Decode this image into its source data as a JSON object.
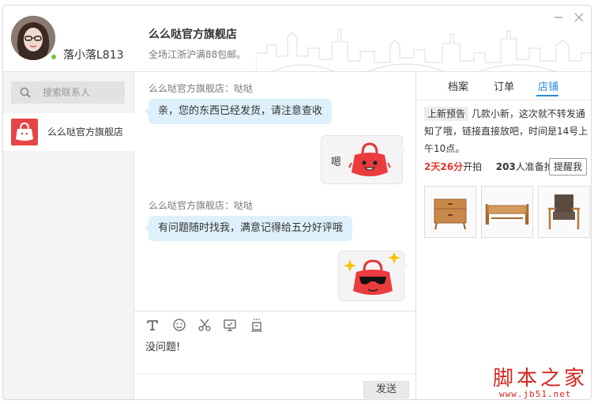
{
  "header": {
    "username": "落小落L813",
    "shop_title": "么么哒官方旗舰店",
    "shop_subtitle": "全场江浙沪满88包邮。"
  },
  "sidebar": {
    "search_placeholder": "搜索联系人",
    "contacts": [
      {
        "name": "么么哒官方旗舰店"
      }
    ]
  },
  "chat": {
    "messages": [
      {
        "sender": "么么哒官方旗舰店：哒哒",
        "text": "亲，您的东西已经发货，请注意查收"
      },
      {
        "text": "嗯",
        "sticker": "red-bag-happy"
      },
      {
        "sender": "么么哒官方旗舰店：哒哒",
        "text": "有问题随时找我，满意记得给五分好评哦"
      },
      {
        "sticker": "red-bag-sunglasses"
      }
    ]
  },
  "composer": {
    "tools": [
      "text-format-icon",
      "emoji-icon",
      "scissors-icon",
      "screen-capture-icon",
      "shake-icon"
    ],
    "draft": "没问题!",
    "send_label": "发送"
  },
  "right_panel": {
    "tabs": [
      "档案",
      "订单",
      "店铺"
    ],
    "active_tab": "店铺",
    "promo_tag": "上新预告",
    "promo_text": "几款小新，这次就不转发通知了哦，链接直接放吧，时间是14号上午10点。",
    "countdown": "2天26分",
    "countdown_suffix": "开拍",
    "prepare_count": "203",
    "prepare_suffix": "人准备抢",
    "remind_label": "提醒我",
    "products": [
      "wooden-cabinet",
      "wooden-bench",
      "wooden-armchair"
    ]
  },
  "watermark": {
    "title": "脚本之家",
    "url": "www.jb51.net"
  },
  "colors": {
    "accent_blue": "#2a8bd8",
    "bubble_blue": "#def0fb",
    "highlight_red": "#e2362d",
    "bag_red": "#e54545"
  }
}
